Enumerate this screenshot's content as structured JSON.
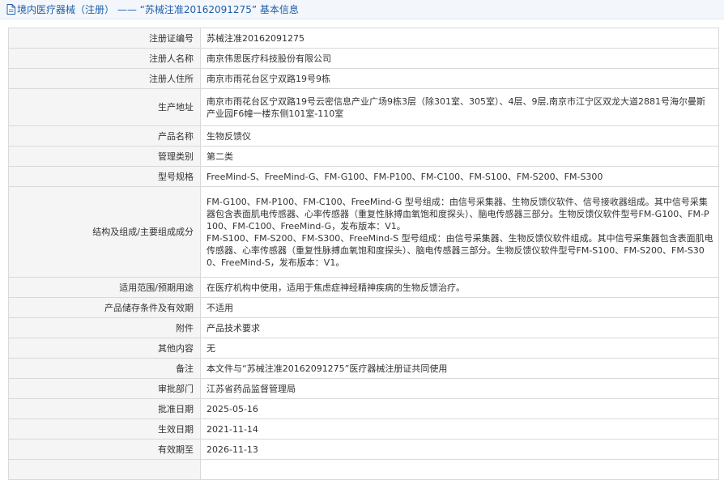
{
  "header": {
    "title": "境内医疗器械（注册） —— “苏械注准20162091275” 基本信息"
  },
  "rows": [
    {
      "label": "注册证编号",
      "value": "苏械注准20162091275"
    },
    {
      "label": "注册人名称",
      "value": "南京伟思医疗科技股份有限公司"
    },
    {
      "label": "注册人住所",
      "value": "南京市雨花台区宁双路19号9栋"
    },
    {
      "label": "生产地址",
      "value": "南京市雨花台区宁双路19号云密信息产业广场9栋3层（除301室、305室）、4层、9层,南京市江宁区双龙大道2881号海尔曼斯产业园F6幢一楼东侧101室-110室"
    },
    {
      "label": "产品名称",
      "value": "生物反馈仪"
    },
    {
      "label": "管理类别",
      "value": "第二类"
    },
    {
      "label": "型号规格",
      "value": "FreeMind-S、FreeMind-G、FM-G100、FM-P100、FM-C100、FM-S100、FM-S200、FM-S300"
    },
    {
      "label": "结构及组成/主要组成成分",
      "value": "FM-G100、FM-P100、FM-C100、FreeMind-G 型号组成：由信号采集器、生物反馈仪软件、信号接收器组成。其中信号采集器包含表面肌电传感器、心率传感器（重复性脉搏血氧饱和度探头）、脑电传感器三部分。生物反馈仪软件型号FM-G100、FM-P100、FM-C100、FreeMind-G，发布版本：V1。",
      "value2": "FM-S100、FM-S200、FM-S300、FreeMind-S 型号组成：由信号采集器、生物反馈仪软件组成。其中信号采集器包含表面肌电传感器、心率传感器（重复性脉搏血氧饱和度探头）、脑电传感器三部分。生物反馈仪软件型号FM-S100、FM-S200、FM-S300、FreeMind-S，发布版本：V1。"
    },
    {
      "label": "适用范围/预期用途",
      "value": "在医疗机构中使用，适用于焦虑症神经精神疾病的生物反馈治疗。"
    },
    {
      "label": "产品储存条件及有效期",
      "value": "不适用"
    },
    {
      "label": "附件",
      "value": "产品技术要求"
    },
    {
      "label": "其他内容",
      "value": "无"
    },
    {
      "label": "备注",
      "value": "本文件与“苏械注准20162091275”医疗器械注册证共同使用"
    },
    {
      "label": "审批部门",
      "value": "江苏省药品监督管理局"
    },
    {
      "label": "批准日期",
      "value": "2025-05-16"
    },
    {
      "label": "生效日期",
      "value": "2021-11-14"
    },
    {
      "label": "有效期至",
      "value": "2026-11-13"
    }
  ]
}
